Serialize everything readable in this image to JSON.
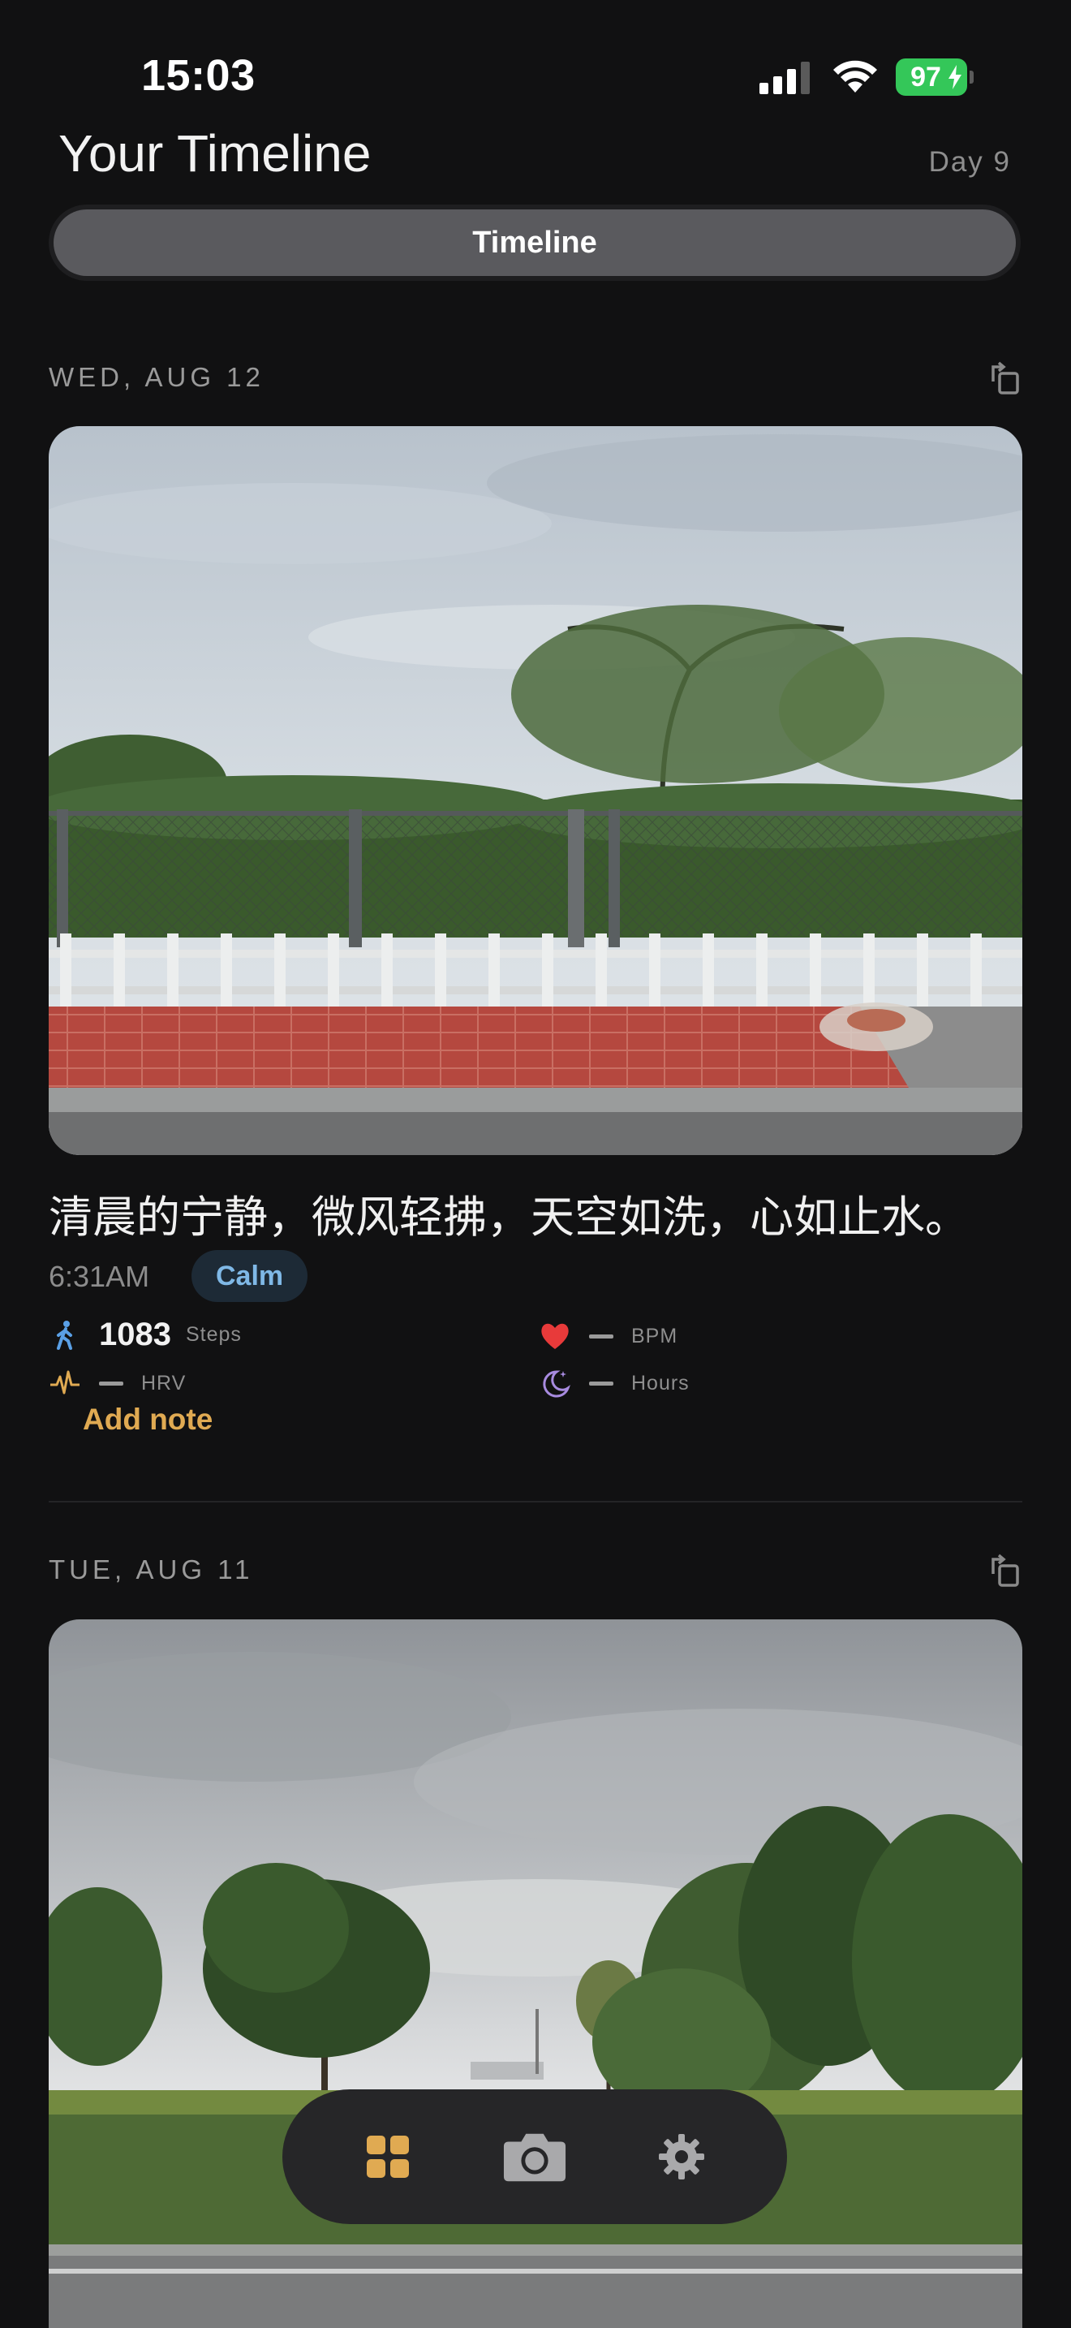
{
  "status_bar": {
    "time": "15:03",
    "battery": "97"
  },
  "header": {
    "title": "Your Timeline",
    "day": "Day 9"
  },
  "segment": {
    "label": "Timeline"
  },
  "entries": [
    {
      "date": "WED, AUG 12",
      "caption": "清晨的宁静，微风轻拂，天空如洗，心如止水。",
      "time": "6:31AM",
      "mood": "Calm",
      "metrics": {
        "steps_value": "1083",
        "steps_unit": "Steps",
        "bpm_unit": "BPM",
        "hrv_unit": "HRV",
        "sleep_unit": "Hours"
      },
      "add_note": "Add note"
    },
    {
      "date": "TUE, AUG 11"
    }
  ],
  "tab_bar": {
    "items": [
      {
        "icon": "grid-icon",
        "active": true
      },
      {
        "icon": "camera-icon",
        "active": false
      },
      {
        "icon": "gear-icon",
        "active": false
      }
    ]
  },
  "colors": {
    "background": "#111112",
    "accent": "#e0aa52",
    "mood_text": "#7fb8e6",
    "heart": "#e83a3a",
    "battery": "#34c759"
  }
}
